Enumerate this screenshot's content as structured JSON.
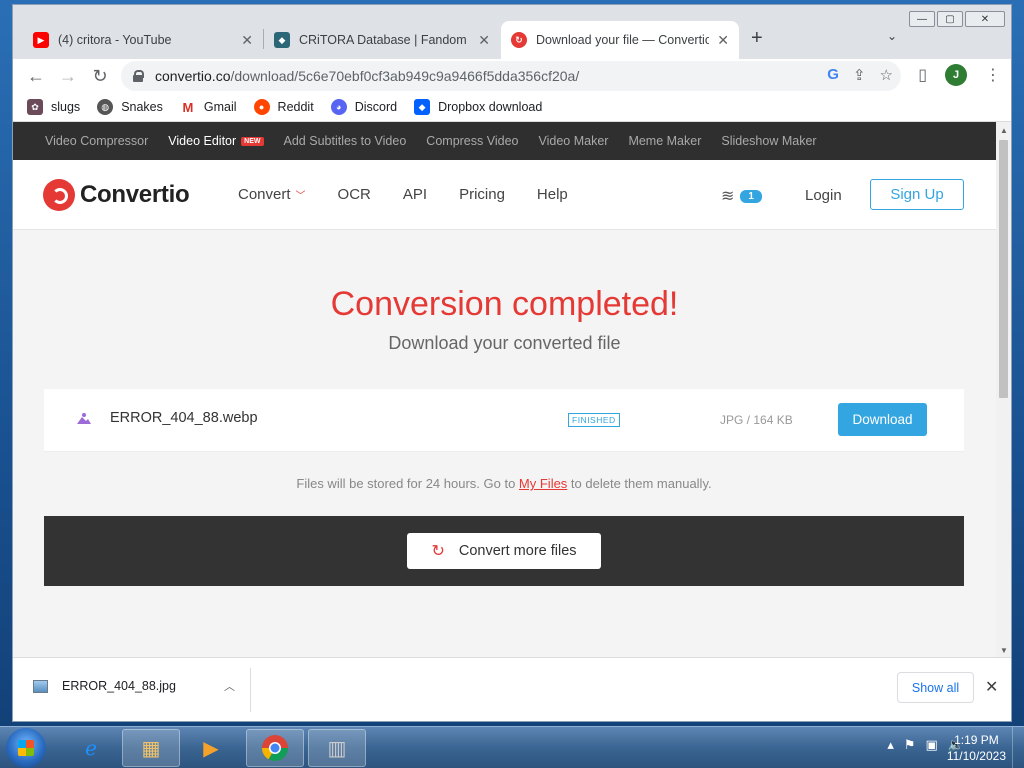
{
  "window_controls": {
    "minimize": "—",
    "maximize": "▢",
    "close": "✕"
  },
  "tabs": [
    {
      "title": "(4) critora - YouTube",
      "icon": "youtube-icon",
      "color": "#ff0000"
    },
    {
      "title": "CRiTORA Database | Fandom",
      "icon": "fandom-icon",
      "color": "#2b6777"
    },
    {
      "title": "Download your file — Convertio",
      "icon": "convertio-icon",
      "color": "#e53935",
      "active": true
    }
  ],
  "toolbar": {
    "url_host": "convertio.co",
    "url_path": "/download/5c6e70ebf0cf3ab949c9a9466f5dda356cf20a/",
    "avatar_letter": "J"
  },
  "bookmarks": [
    {
      "label": "slugs",
      "icon": "slugs-icon",
      "color": "#6b4b5a"
    },
    {
      "label": "Snakes",
      "icon": "globe-icon",
      "color": "#555555"
    },
    {
      "label": "Gmail",
      "icon": "gmail-icon",
      "color": "#d93025"
    },
    {
      "label": "Reddit",
      "icon": "reddit-icon",
      "color": "#ff4500"
    },
    {
      "label": "Discord",
      "icon": "discord-icon",
      "color": "#5865f2"
    },
    {
      "label": "Dropbox download",
      "icon": "dropbox-icon",
      "color": "#0061ff"
    }
  ],
  "site": {
    "topnav": [
      {
        "label": "Video Compressor"
      },
      {
        "label": "Video Editor",
        "badge": "NEW",
        "highlight": true
      },
      {
        "label": "Add Subtitles to Video"
      },
      {
        "label": "Compress Video"
      },
      {
        "label": "Video Maker"
      },
      {
        "label": "Meme Maker"
      },
      {
        "label": "Slideshow Maker"
      }
    ],
    "logo_text": "Convertio",
    "mainnav": [
      {
        "label": "Convert",
        "dropdown": true
      },
      {
        "label": "OCR"
      },
      {
        "label": "API"
      },
      {
        "label": "Pricing"
      },
      {
        "label": "Help"
      }
    ],
    "files_count": "1",
    "login": "Login",
    "signup": "Sign Up",
    "headline": "Conversion completed!",
    "subline": "Download your converted file",
    "file": {
      "name": "ERROR_404_88.webp",
      "status": "FINISHED",
      "meta": "JPG / 164 KB",
      "download": "Download"
    },
    "store_note_before": "Files will be stored for 24 hours. Go to ",
    "store_note_link": "My Files",
    "store_note_after": " to delete them manually.",
    "convert_more": "Convert more files",
    "accent": "#e53935",
    "blue": "#33a5e1"
  },
  "shelf": {
    "filename": "ERROR_404_88.jpg",
    "show_all": "Show all"
  },
  "taskbar": {
    "time": "1:19 PM",
    "date": "11/10/2023"
  }
}
